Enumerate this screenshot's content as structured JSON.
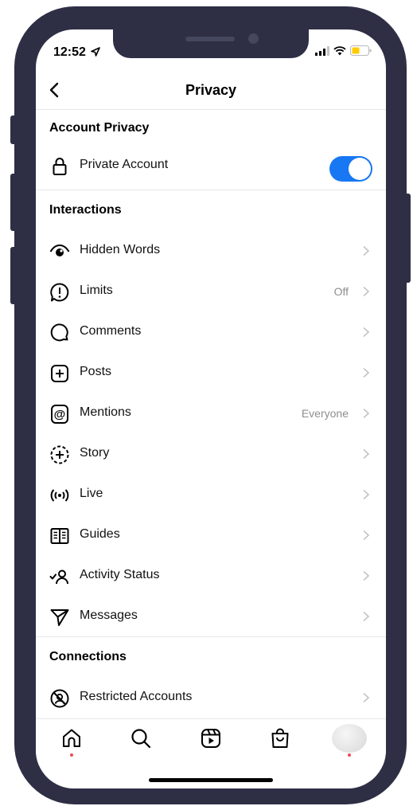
{
  "status": {
    "time": "12:52"
  },
  "header": {
    "title": "Privacy"
  },
  "account_privacy": {
    "section_title": "Account Privacy",
    "private_account": {
      "label": "Private Account",
      "enabled": true
    }
  },
  "interactions": {
    "section_title": "Interactions",
    "items": [
      {
        "label": "Hidden Words",
        "value": "",
        "icon": "eye-icon"
      },
      {
        "label": "Limits",
        "value": "Off",
        "icon": "limits-icon"
      },
      {
        "label": "Comments",
        "value": "",
        "icon": "comment-icon"
      },
      {
        "label": "Posts",
        "value": "",
        "icon": "add-post-icon"
      },
      {
        "label": "Mentions",
        "value": "Everyone",
        "icon": "at-icon"
      },
      {
        "label": "Story",
        "value": "",
        "icon": "story-icon"
      },
      {
        "label": "Live",
        "value": "",
        "icon": "live-icon"
      },
      {
        "label": "Guides",
        "value": "",
        "icon": "guides-icon"
      },
      {
        "label": "Activity Status",
        "value": "",
        "icon": "activity-status-icon"
      },
      {
        "label": "Messages",
        "value": "",
        "icon": "send-icon"
      }
    ]
  },
  "connections": {
    "section_title": "Connections",
    "items": [
      {
        "label": "Restricted Accounts",
        "value": "",
        "icon": "restricted-icon"
      }
    ]
  },
  "tabs": [
    "home-icon",
    "search-icon",
    "reels-icon",
    "shop-icon",
    "profile-avatar"
  ],
  "colors": {
    "toggle": "#1877f2",
    "badge": "#ed4956",
    "frame": "#2e2f45"
  }
}
